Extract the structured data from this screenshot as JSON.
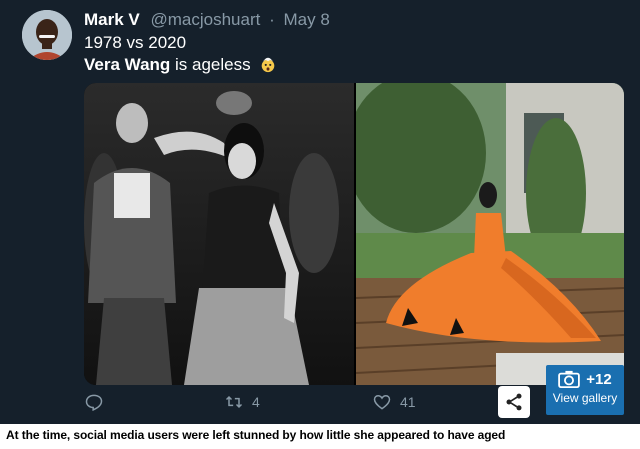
{
  "tweet": {
    "display_name": "Mark V",
    "handle": "@macjoshuart",
    "separator": "·",
    "date": "May 8",
    "line1": "1978 vs 2020",
    "line2_bold": "Vera Wang",
    "line2_rest": " is ageless",
    "emoji": "exploding-head-emoji",
    "media": {
      "left_photo": "black-and-white disco photo",
      "right_photo": "orange gown garden photo"
    },
    "actions": {
      "reply_icon": "reply-icon",
      "retweet_count": "4",
      "like_count": "41",
      "share_icon": "share-icon"
    }
  },
  "gallery": {
    "count": "+12",
    "label": "View gallery",
    "icon": "camera-icon",
    "color": "#1a6fb0"
  },
  "caption": "At the time, social media users were left stunned by how little she appeared to have aged",
  "colors": {
    "background": "#15202b",
    "secondary_text": "#8899a6",
    "gown": "#f07d2c"
  }
}
